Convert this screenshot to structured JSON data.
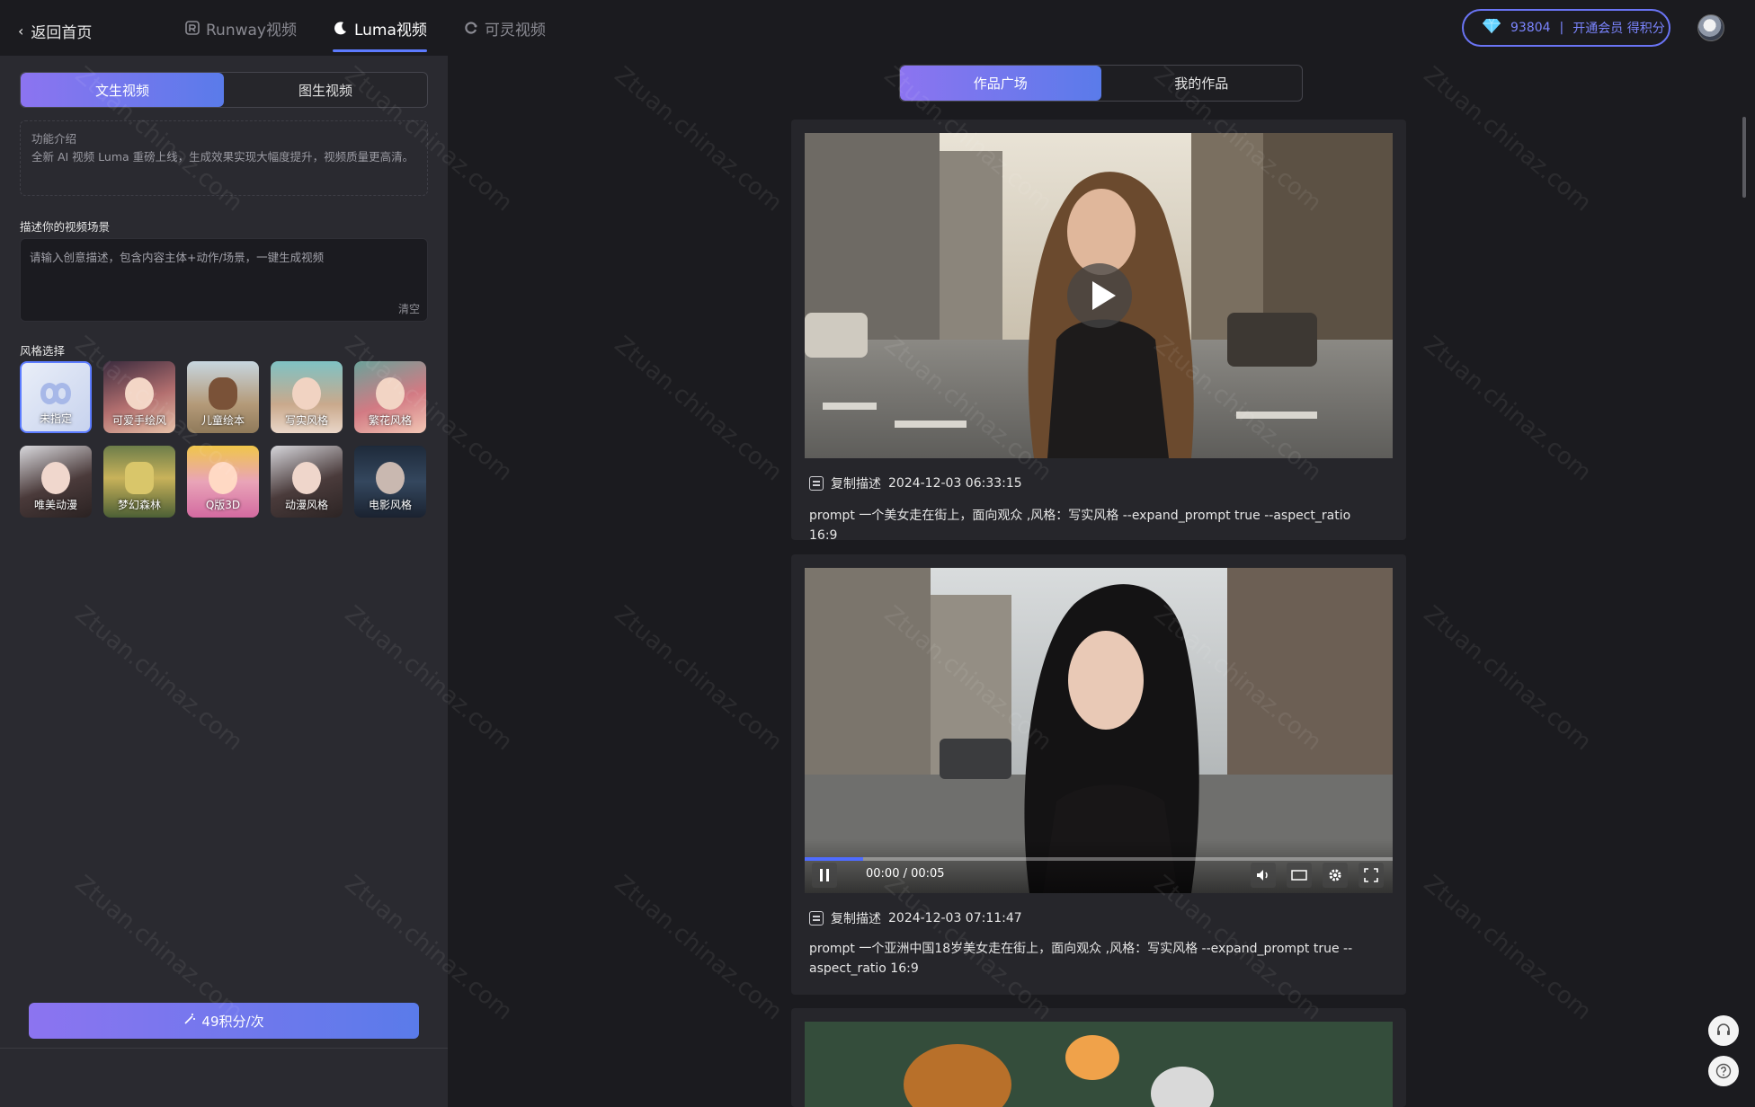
{
  "header": {
    "back_label": "返回首页",
    "tabs": [
      {
        "label": "Runway视频"
      },
      {
        "label": "Luma视频"
      },
      {
        "label": "可灵视频"
      }
    ],
    "points": {
      "value": "93804",
      "separator": "|",
      "cta": "开通会员 得积分"
    }
  },
  "sidebar": {
    "modes": [
      "文生视频",
      "图生视频"
    ],
    "intro_title": "功能介绍",
    "intro_text": "全新 AI 视频 Luma 重磅上线，生成效果实现大幅度提升，视频质量更高清。",
    "prompt_label": "描述你的视频场景",
    "prompt_placeholder": "请输入创意描述，包含内容主体+动作/场景，一键生成视频",
    "clear_label": "清空",
    "style_label": "风格选择",
    "styles": [
      {
        "name": "未指定"
      },
      {
        "name": "可爱手绘风"
      },
      {
        "name": "儿童绘本"
      },
      {
        "name": "写实风格"
      },
      {
        "name": "繁花风格"
      },
      {
        "name": "唯美动漫"
      },
      {
        "name": "梦幻森林"
      },
      {
        "name": "Q版3D"
      },
      {
        "name": "动漫风格"
      },
      {
        "name": "电影风格"
      }
    ],
    "generate_label": "49积分/次"
  },
  "gallery": {
    "tabs": [
      "作品广场",
      "我的作品"
    ],
    "cards": [
      {
        "copy_label": "复制描述",
        "time": "2024-12-03 06:33:15",
        "prompt": "prompt 一个美女走在街上，面向观众 ,风格：写实风格 --expand_prompt true --aspect_ratio 16:9"
      },
      {
        "copy_label": "复制描述",
        "time": "2024-12-03 07:11:47",
        "prompt": "prompt 一个亚洲中国18岁美女走在街上，面向观众 ,风格：写实风格 --expand_prompt true --aspect_ratio 16:9",
        "player": {
          "time": "00:00 / 00:05",
          "progress": 0.1
        }
      }
    ]
  },
  "watermark": "Ztuan.chinaz.com",
  "colors": {
    "accent": "#5d7bff",
    "gradient_start": "#8c74f0",
    "gradient_end": "#5a7bea"
  }
}
